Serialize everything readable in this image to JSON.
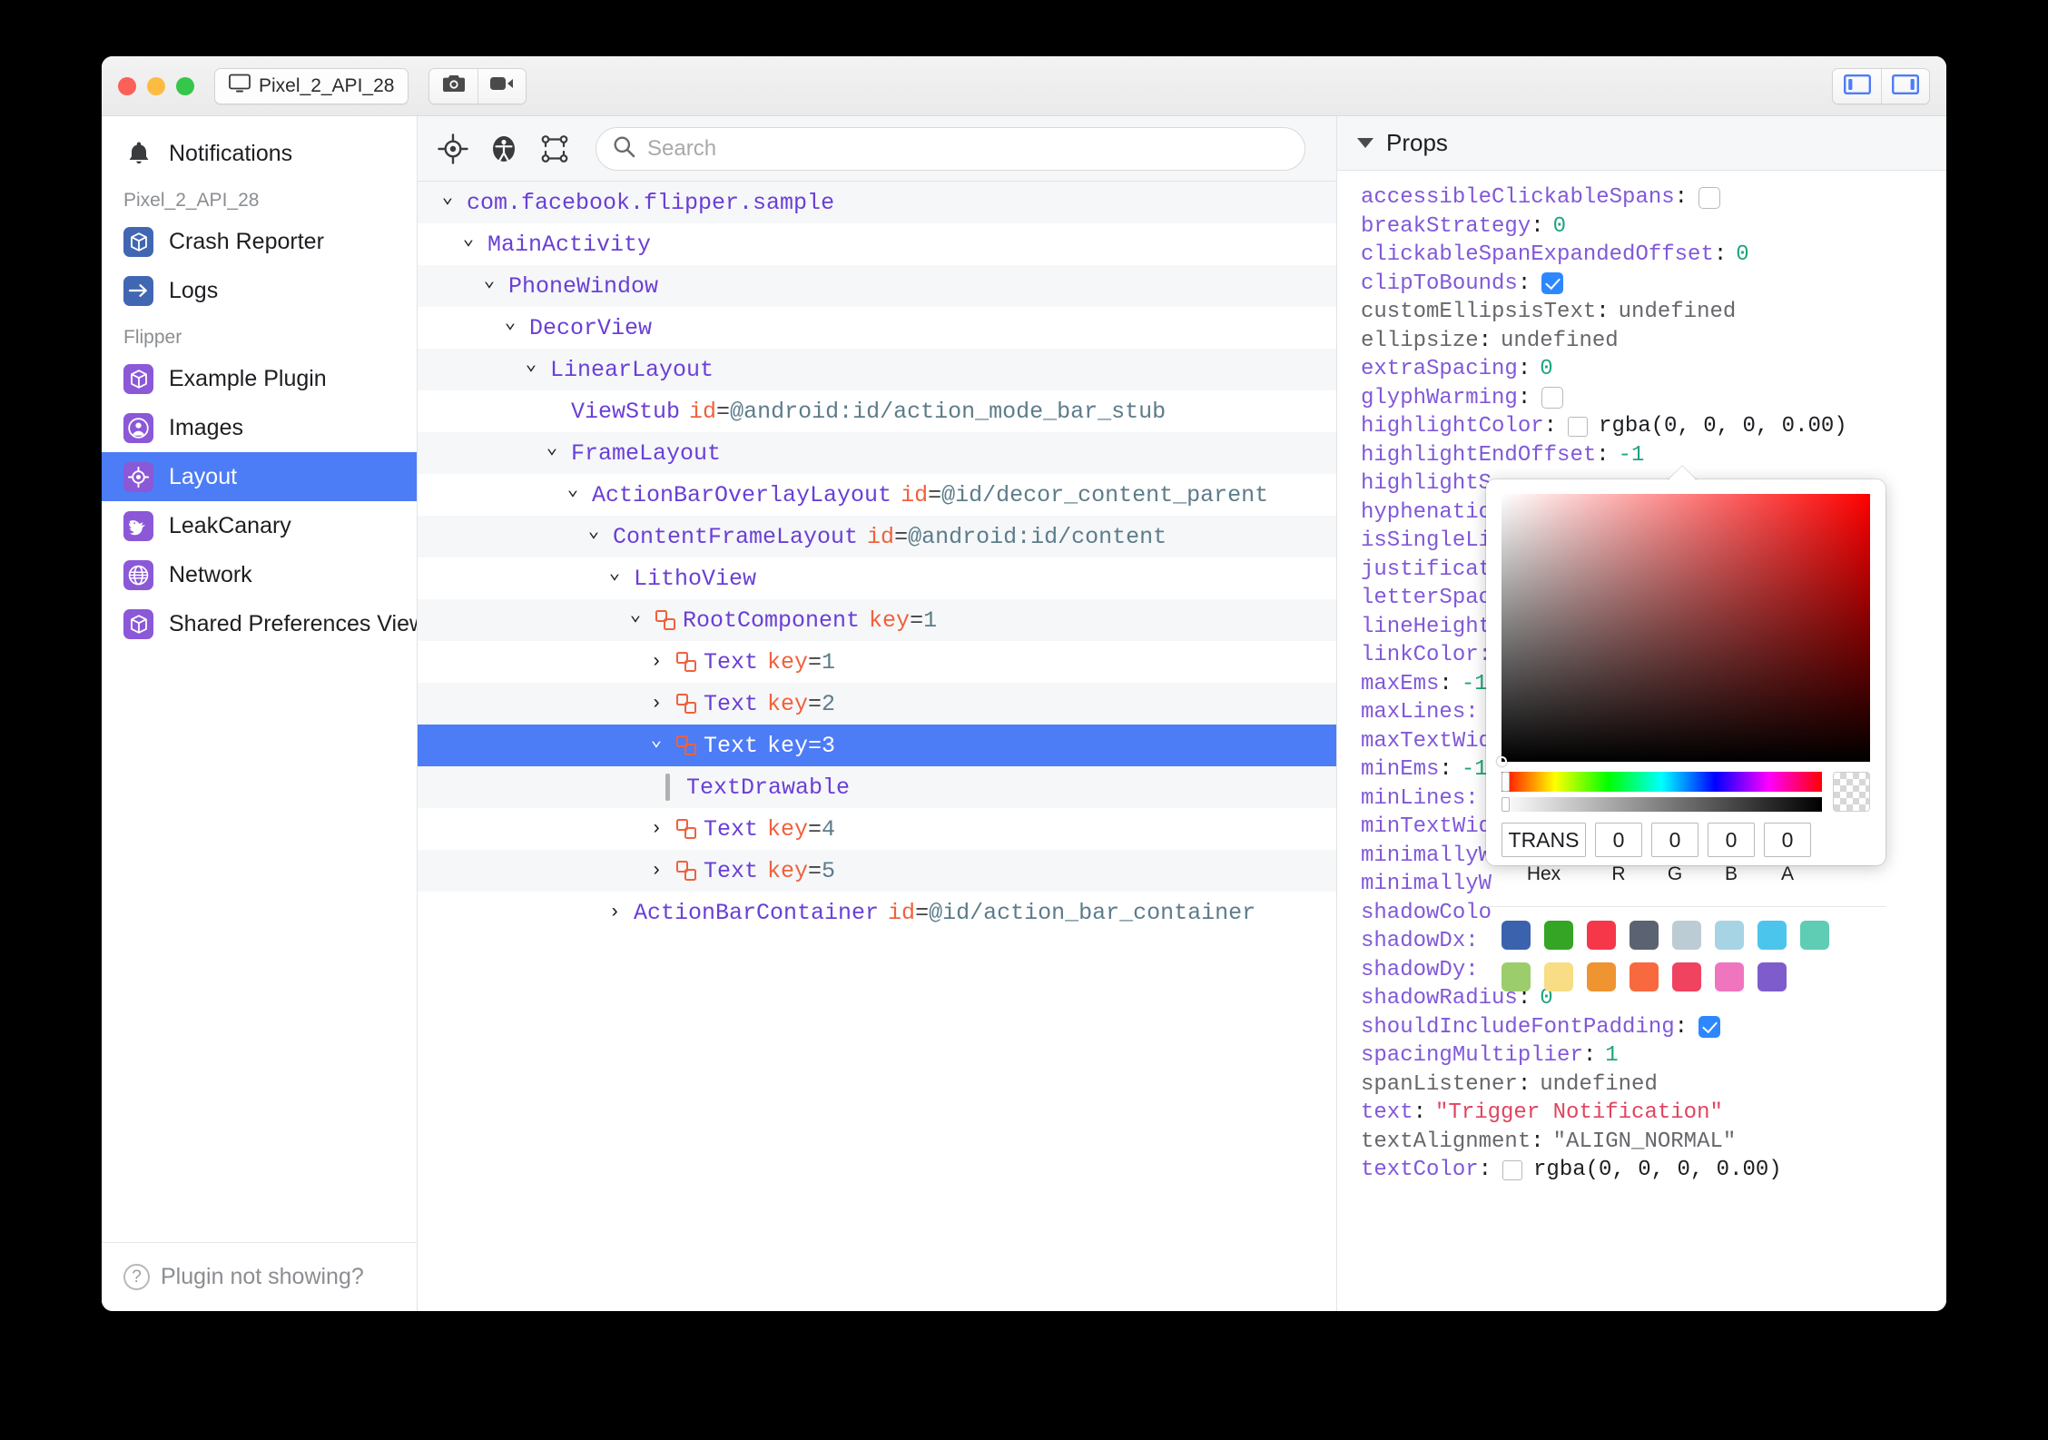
{
  "titlebar": {
    "device_pill": "Pixel_2_API_28",
    "device_icon": "monitor-icon",
    "screenshot_icon": "camera-icon",
    "record_icon": "video-camera-icon",
    "left_panel_icon": "left-sidebar-toggle-icon",
    "right_panel_icon": "right-sidebar-toggle-icon",
    "traffic": {
      "close": "close",
      "minimize": "minimize",
      "zoom": "zoom"
    }
  },
  "sidebar": {
    "notifications": {
      "label": "Notifications",
      "icon": "bell-icon"
    },
    "device_group_label": "Pixel_2_API_28",
    "device_plugins": [
      {
        "label": "Crash Reporter",
        "icon": "cube-icon",
        "color": "#4267b2"
      },
      {
        "label": "Logs",
        "icon": "arrow-right-icon",
        "color": "#4267b2"
      }
    ],
    "flipper_group_label": "Flipper",
    "flipper_plugins": [
      {
        "label": "Example Plugin",
        "icon": "cube-icon",
        "color": "#8b58d8",
        "selected": false
      },
      {
        "label": "Images",
        "icon": "person-circle-icon",
        "color": "#8b58d8",
        "selected": false
      },
      {
        "label": "Layout",
        "icon": "target-icon",
        "color": "#8b58d8",
        "selected": true
      },
      {
        "label": "LeakCanary",
        "icon": "bird-icon",
        "color": "#8b58d8",
        "selected": false
      },
      {
        "label": "Network",
        "icon": "globe-icon",
        "color": "#8b58d8",
        "selected": false
      },
      {
        "label": "Shared Preferences Viewe",
        "icon": "cube-icon",
        "color": "#8b58d8",
        "selected": false
      }
    ],
    "footer": {
      "label": "Plugin not showing?",
      "icon": "question-circle-icon"
    },
    "selected_color": "#4d7cf7"
  },
  "tree_toolbar": {
    "target_icon": "crosshair-target-icon",
    "accessibility_icon": "accessibility-icon",
    "layout_bounds_icon": "layout-bounds-icon",
    "search_placeholder": "Search",
    "search_value": "",
    "search_icon": "search-icon"
  },
  "tree": {
    "rows": [
      {
        "indent": 0,
        "caret": "down",
        "litho": false,
        "name": "com.facebook.flipper.sample",
        "attr_key": "",
        "attr_val": ""
      },
      {
        "indent": 1,
        "caret": "down",
        "litho": false,
        "name": "MainActivity",
        "attr_key": "",
        "attr_val": ""
      },
      {
        "indent": 2,
        "caret": "down",
        "litho": false,
        "name": "PhoneWindow",
        "attr_key": "",
        "attr_val": ""
      },
      {
        "indent": 3,
        "caret": "down",
        "litho": false,
        "name": "DecorView",
        "attr_key": "",
        "attr_val": ""
      },
      {
        "indent": 4,
        "caret": "down",
        "litho": false,
        "name": "LinearLayout",
        "attr_key": "",
        "attr_val": ""
      },
      {
        "indent": 5,
        "caret": "none",
        "litho": false,
        "name": "ViewStub",
        "attr_key": "id",
        "attr_val": "@android:id/action_mode_bar_stub"
      },
      {
        "indent": 5,
        "caret": "down",
        "litho": false,
        "name": "FrameLayout",
        "attr_key": "",
        "attr_val": ""
      },
      {
        "indent": 6,
        "caret": "down",
        "litho": false,
        "name": "ActionBarOverlayLayout",
        "attr_key": "id",
        "attr_val": "@id/decor_content_parent"
      },
      {
        "indent": 7,
        "caret": "down",
        "litho": false,
        "name": "ContentFrameLayout",
        "attr_key": "id",
        "attr_val": "@android:id/content"
      },
      {
        "indent": 8,
        "caret": "down",
        "litho": false,
        "name": "LithoView",
        "attr_key": "",
        "attr_val": ""
      },
      {
        "indent": 9,
        "caret": "down",
        "litho": true,
        "name": "RootComponent",
        "attr_key": "key",
        "attr_val": "1"
      },
      {
        "indent": 10,
        "caret": "right",
        "litho": true,
        "name": "Text",
        "attr_key": "key",
        "attr_val": "1"
      },
      {
        "indent": 10,
        "caret": "right",
        "litho": true,
        "name": "Text",
        "attr_key": "key",
        "attr_val": "2"
      },
      {
        "indent": 10,
        "caret": "down",
        "litho": true,
        "name": "Text",
        "attr_key": "key",
        "attr_val": "3",
        "selected": true
      },
      {
        "indent": 11,
        "caret": "leaf",
        "litho": false,
        "name": "TextDrawable",
        "attr_key": "",
        "attr_val": ""
      },
      {
        "indent": 10,
        "caret": "right",
        "litho": true,
        "name": "Text",
        "attr_key": "key",
        "attr_val": "4"
      },
      {
        "indent": 10,
        "caret": "right",
        "litho": true,
        "name": "Text",
        "attr_key": "key",
        "attr_val": "5"
      },
      {
        "indent": 8,
        "caret": "right",
        "litho": false,
        "name": "ActionBarContainer",
        "attr_key": "id",
        "attr_val": "@id/action_bar_container"
      }
    ]
  },
  "props": {
    "header": "Props",
    "rows": [
      {
        "key": "accessibleClickableSpans",
        "type": "checkbox",
        "checked": false
      },
      {
        "key": "breakStrategy",
        "type": "number",
        "value": "0"
      },
      {
        "key": "clickableSpanExpandedOffset",
        "type": "number",
        "value": "0"
      },
      {
        "key": "clipToBounds",
        "type": "checkbox",
        "checked": true
      },
      {
        "key": "customEllipsisText",
        "type": "undefined",
        "dim": true,
        "value": "undefined"
      },
      {
        "key": "ellipsize",
        "type": "undefined",
        "dim": true,
        "value": "undefined"
      },
      {
        "key": "extraSpacing",
        "type": "number",
        "value": "0"
      },
      {
        "key": "glyphWarming",
        "type": "checkbox",
        "checked": false
      },
      {
        "key": "highlightColor",
        "type": "color",
        "value": "rgba(0, 0, 0, 0.00)"
      },
      {
        "key": "highlightEndOffset",
        "type": "number",
        "value": "-1"
      },
      {
        "key": "highlightS",
        "type": "clipped"
      },
      {
        "key": "hyphenatio",
        "type": "clipped"
      },
      {
        "key": "isSingleLi",
        "type": "clipped"
      },
      {
        "key": "justificat",
        "type": "clipped"
      },
      {
        "key": "letterSpac",
        "type": "clipped"
      },
      {
        "key": "lineHeight",
        "type": "clipped"
      },
      {
        "key": "linkColor:",
        "type": "clipped"
      },
      {
        "key": "maxEms",
        "type": "number",
        "value": "-1"
      },
      {
        "key": "maxLines:",
        "type": "clipped"
      },
      {
        "key": "maxTextWid",
        "type": "clipped"
      },
      {
        "key": "minEms",
        "type": "number",
        "value": "-1"
      },
      {
        "key": "minLines:",
        "type": "clipped"
      },
      {
        "key": "minTextWid",
        "type": "clipped"
      },
      {
        "key": "minimallyW",
        "type": "clipped"
      },
      {
        "key": "minimallyW",
        "type": "clipped"
      },
      {
        "key": "shadowColo",
        "type": "clipped"
      },
      {
        "key": "shadowDx:",
        "type": "clipped"
      },
      {
        "key": "shadowDy:",
        "type": "clipped"
      },
      {
        "key": "shadowRadius",
        "type": "number",
        "value": "0"
      },
      {
        "key": "shouldIncludeFontPadding",
        "type": "checkbox",
        "checked": true
      },
      {
        "key": "spacingMultiplier",
        "type": "number",
        "value": "1"
      },
      {
        "key": "spanListener",
        "type": "undefined",
        "dim": true,
        "value": "undefined"
      },
      {
        "key": "text",
        "type": "string",
        "value": "\"Trigger Notification\""
      },
      {
        "key": "textAlignment",
        "type": "string",
        "dim": true,
        "value": "\"ALIGN_NORMAL\""
      },
      {
        "key": "textColor",
        "type": "color",
        "value": "rgba(0, 0, 0, 0.00)"
      }
    ]
  },
  "color_picker": {
    "hex_label": "Hex",
    "hex_value": "TRANS",
    "channels": [
      {
        "label": "R",
        "value": "0"
      },
      {
        "label": "G",
        "value": "0"
      },
      {
        "label": "B",
        "value": "0"
      },
      {
        "label": "A",
        "value": "0"
      }
    ],
    "swatch_rows": [
      [
        "#3b62ad",
        "#34a524",
        "#f6374a",
        "#5b6271",
        "#bcccd4",
        "#a6d4e5",
        "#4cc5ed",
        "#5ecdb3"
      ],
      [
        "#9ccd6c",
        "#f8dd85",
        "#ee9430",
        "#f8693f",
        "#ef4360",
        "#f075bf",
        "#7e5ccb"
      ]
    ]
  }
}
